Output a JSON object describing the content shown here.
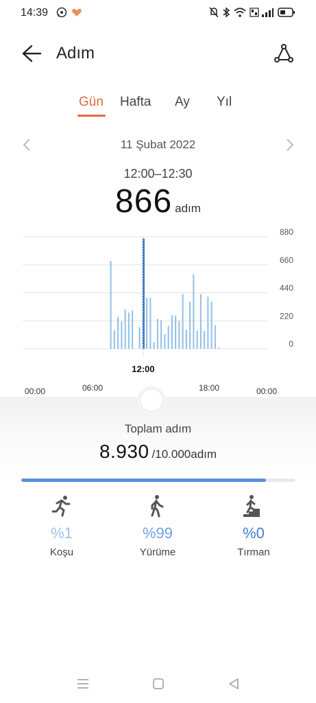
{
  "status": {
    "time": "14:39"
  },
  "header": {
    "title": "Adım"
  },
  "tabs": [
    {
      "label": "Gün",
      "active": true
    },
    {
      "label": "Hafta",
      "active": false
    },
    {
      "label": "Ay",
      "active": false
    },
    {
      "label": "Yıl",
      "active": false
    }
  ],
  "date": "11 Şubat 2022",
  "selected": {
    "range": "12:00–12:30",
    "steps": "866",
    "unit": "adım"
  },
  "chart_data": {
    "type": "bar",
    "y_ticks": [
      "880",
      "660",
      "440",
      "220",
      "0"
    ],
    "ylim": [
      0,
      880
    ],
    "x_ticks": [
      "00:00",
      "06:00",
      "12:00",
      "18:00",
      "00:00"
    ],
    "selected_label": "12:00",
    "values": [
      0,
      0,
      0,
      0,
      0,
      0,
      0,
      0,
      0,
      0,
      0,
      0,
      0,
      0,
      0,
      0,
      0,
      0,
      0,
      0,
      0,
      0,
      0,
      0,
      690,
      145,
      250,
      215,
      310,
      285,
      300,
      0,
      170,
      866,
      400,
      400,
      50,
      235,
      225,
      115,
      180,
      265,
      260,
      220,
      430,
      150,
      370,
      585,
      140,
      430,
      140,
      410,
      370,
      185,
      10,
      0,
      0,
      0,
      0,
      0,
      0,
      0,
      0,
      0,
      0,
      0,
      0,
      0
    ],
    "selected_index": 33
  },
  "summary": {
    "label": "Toplam adım",
    "value": "8.930",
    "goal": "/10.000adım",
    "progress": 0.893
  },
  "activities": [
    {
      "pct": "%1",
      "label": "Koşu",
      "icon": "running-icon",
      "color": "#9ec0ea"
    },
    {
      "pct": "%99",
      "label": "Yürüme",
      "icon": "walking-icon",
      "color": "#6fa0e0"
    },
    {
      "pct": "%0",
      "label": "Tırman",
      "icon": "climbing-icon",
      "color": "#3e7fd4"
    }
  ],
  "colors": {
    "accent": "#e8683a",
    "bar": "#8fbfe8",
    "bar_selected": "#2e6fc4"
  }
}
